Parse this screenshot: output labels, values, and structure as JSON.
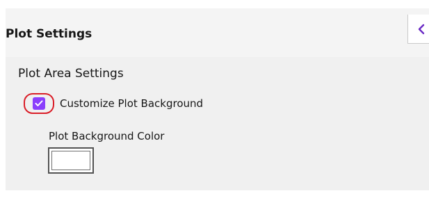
{
  "header": {
    "title": "Plot Settings",
    "collapse_icon": "chevron-left-icon"
  },
  "plot_area": {
    "section_title": "Plot Area Settings",
    "customize_background": {
      "label": "Customize Plot Background",
      "checked": true,
      "check_icon": "checkmark-icon"
    },
    "background_color": {
      "label": "Plot Background Color",
      "value": "#ffffff"
    }
  },
  "colors": {
    "accent": "#8a3ffc",
    "highlight_ring": "#da1e28",
    "panel_background": "#f0f0f0",
    "header_background": "#f4f4f4"
  }
}
